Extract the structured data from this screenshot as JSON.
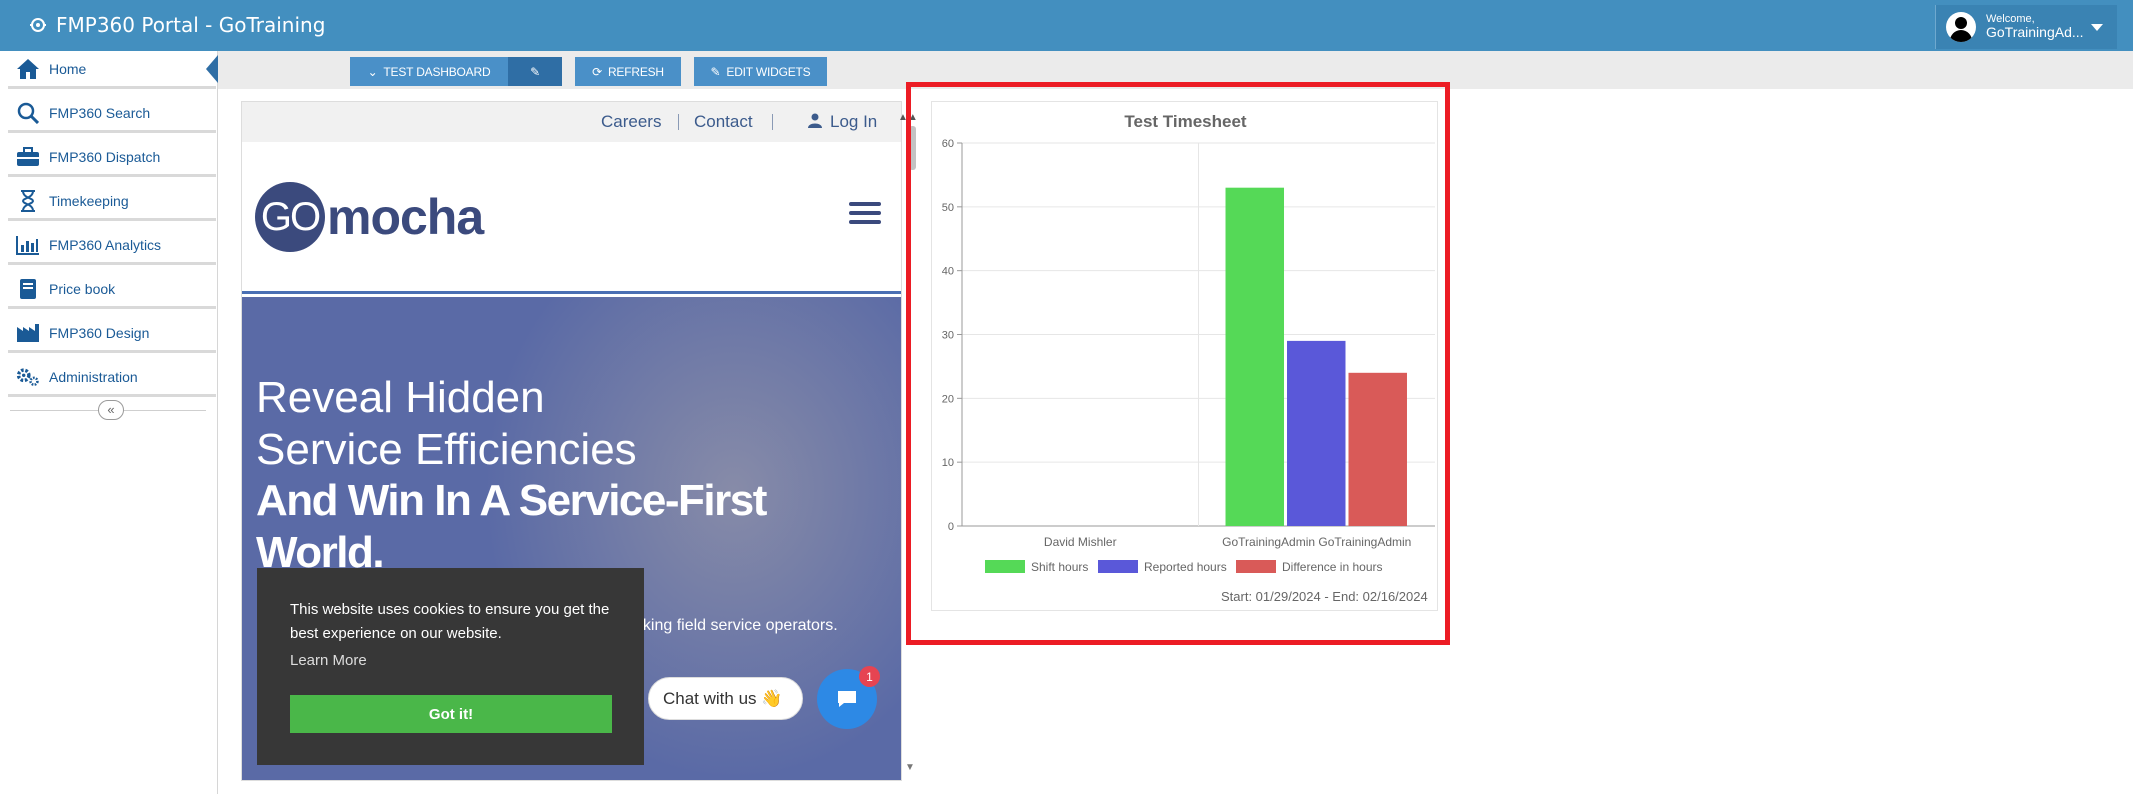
{
  "app": {
    "title": "FMP360 Portal - GoTraining",
    "welcome_label": "Welcome,",
    "user_name": "GoTrainingAd..."
  },
  "sidebar": {
    "items": [
      {
        "label": "Home",
        "icon": "home-icon"
      },
      {
        "label": "FMP360 Search",
        "icon": "search-icon"
      },
      {
        "label": "FMP360 Dispatch",
        "icon": "briefcase-icon"
      },
      {
        "label": "Timekeeping",
        "icon": "hourglass-icon"
      },
      {
        "label": "FMP360 Analytics",
        "icon": "bar-chart-icon"
      },
      {
        "label": "Price book",
        "icon": "book-icon"
      },
      {
        "label": "FMP360 Design",
        "icon": "factory-icon"
      },
      {
        "label": "Administration",
        "icon": "gears-icon"
      }
    ]
  },
  "toolbar": {
    "dashboard_label": "TEST DASHBOARD",
    "refresh_label": "REFRESH",
    "edit_widgets_label": "EDIT WIDGETS"
  },
  "website": {
    "nav": {
      "careers": "Careers",
      "contact": "Contact",
      "login": "Log In"
    },
    "logo_go": "GO",
    "logo_mocha": "mocha",
    "hero_line1": "Reveal Hidden",
    "hero_line2": "Service Efficiencies",
    "hero_bold": "And Win In A Service-First World.",
    "hero_sub": "oking field service operators.",
    "cookie_message": "This website uses cookies to ensure you get the best experience on our website.",
    "cookie_learn_more": "Learn More",
    "cookie_button": "Got it!",
    "chat_label": "Chat with us 👋",
    "chat_badge": "1"
  },
  "chart_widget": {
    "date_range": "Start: 01/29/2024 - End: 02/16/2024"
  },
  "colors": {
    "topbar": "#438fbf",
    "shift_hours": "#55d957",
    "reported_hours": "#5a58d9",
    "difference_hours": "#d95a58",
    "highlight": "#ec1c24"
  },
  "chart_data": {
    "type": "bar",
    "title": "Test Timesheet",
    "categories": [
      "David Mishler",
      "GoTrainingAdmin GoTrainingAdmin"
    ],
    "series": [
      {
        "name": "Shift hours",
        "values": [
          0,
          53
        ]
      },
      {
        "name": "Reported hours",
        "values": [
          0,
          29
        ]
      },
      {
        "name": "Difference in hours",
        "values": [
          0,
          24
        ]
      }
    ],
    "ylim": [
      0,
      60
    ],
    "yticks": [
      0,
      10,
      20,
      30,
      40,
      50,
      60
    ],
    "grid": true,
    "legend": "bottom"
  }
}
